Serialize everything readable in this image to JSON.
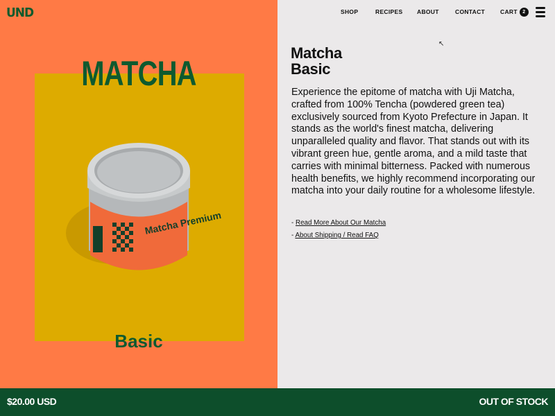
{
  "brand": {
    "logo_text": "UND"
  },
  "nav": {
    "items": [
      {
        "label": "SHOP"
      },
      {
        "label": "RECIPES"
      },
      {
        "label": "ABOUT"
      },
      {
        "label": "CONTACT"
      }
    ],
    "cart_label": "CART",
    "cart_count": "2",
    "menu_icon": "hamburger-icon"
  },
  "hero": {
    "title": "MATCHA",
    "subtitle": "Basic",
    "tin_label_title": "Matcha Premium"
  },
  "product": {
    "name_line1": "Matcha",
    "name_line2": "Basic",
    "description": "Experience the epitome of matcha with Uji Matcha, crafted from 100% Tencha (powdered green tea) exclusively sourced from Kyoto Prefecture in Japan. It stands as the world's finest matcha, delivering unparalleled quality and flavor. That stands out with its vibrant green hue, gentle aroma, and a mild taste that carries with minimal bitterness. Packed with numerous health benefits, we highly recommend incorporating our matcha into your daily routine for a wholesome lifestyle.",
    "links": [
      {
        "prefix": "-",
        "label": "Read More About Our Matcha"
      },
      {
        "prefix": "-",
        "label": "About Shipping / Read FAQ"
      }
    ]
  },
  "footer": {
    "price": "$20.00 USD",
    "stock_status": "OUT OF STOCK"
  },
  "colors": {
    "left_bg": "#ff7a45",
    "image_bg": "#ddab00",
    "brand_green": "#0d4e2b",
    "right_bg": "#ebe9ea"
  }
}
